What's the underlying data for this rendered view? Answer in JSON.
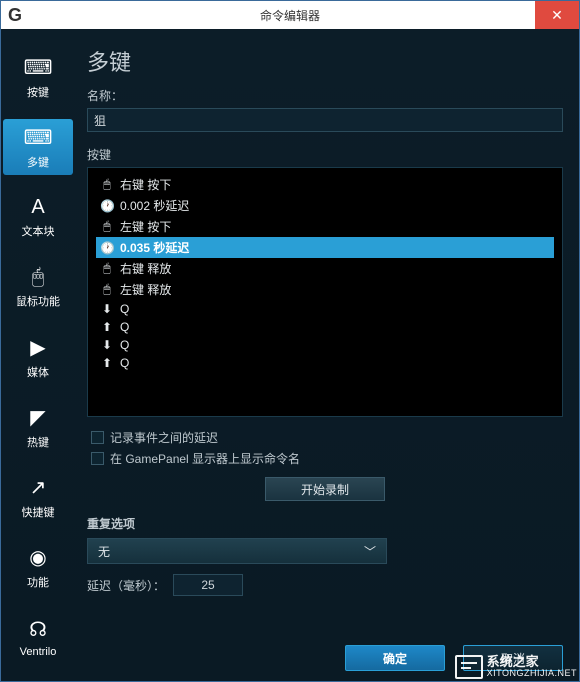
{
  "window": {
    "logo": "G",
    "title": "命令编辑器",
    "close": "✕"
  },
  "sidebar": {
    "items": [
      {
        "label": "按键",
        "icon": "⌨"
      },
      {
        "label": "多键",
        "icon": "⌨"
      },
      {
        "label": "文本块",
        "icon": "A"
      },
      {
        "label": "鼠标功能",
        "icon": "🖱"
      },
      {
        "label": "媒体",
        "icon": "▶"
      },
      {
        "label": "热键",
        "icon": "◤"
      },
      {
        "label": "快捷键",
        "icon": "↗"
      },
      {
        "label": "功能",
        "icon": "◉"
      },
      {
        "label": "Ventrilo",
        "icon": "☊"
      }
    ]
  },
  "main": {
    "heading": "多键",
    "name_label": "名称：",
    "name_value": "狙",
    "keys_label": "按键",
    "keys": [
      {
        "icon": "mouse",
        "text": "右键 按下"
      },
      {
        "icon": "clock",
        "text": "0.002 秒延迟"
      },
      {
        "icon": "mouse",
        "text": "左键 按下"
      },
      {
        "icon": "clock",
        "text": "0.035 秒延迟",
        "selected": true
      },
      {
        "icon": "mouse",
        "text": "右键 释放"
      },
      {
        "icon": "mouse",
        "text": "左键 释放"
      },
      {
        "icon": "down",
        "text": "Q"
      },
      {
        "icon": "up",
        "text": "Q"
      },
      {
        "icon": "down",
        "text": "Q"
      },
      {
        "icon": "up",
        "text": "Q"
      }
    ],
    "chk1": "记录事件之间的延迟",
    "chk2": "在 GamePanel 显示器上显示命令名",
    "record_btn": "开始录制",
    "repeat_label": "重复选项",
    "repeat_value": "无",
    "delay_label": "延迟（毫秒）：",
    "delay_value": "25",
    "ok": "确定",
    "cancel": "取消"
  },
  "watermark": {
    "title": "系统之家",
    "sub": "XITONGZHIJIA.NET"
  },
  "icon_map": {
    "mouse": "🖱",
    "clock": "🕐",
    "down": "⬇",
    "up": "⬆"
  }
}
